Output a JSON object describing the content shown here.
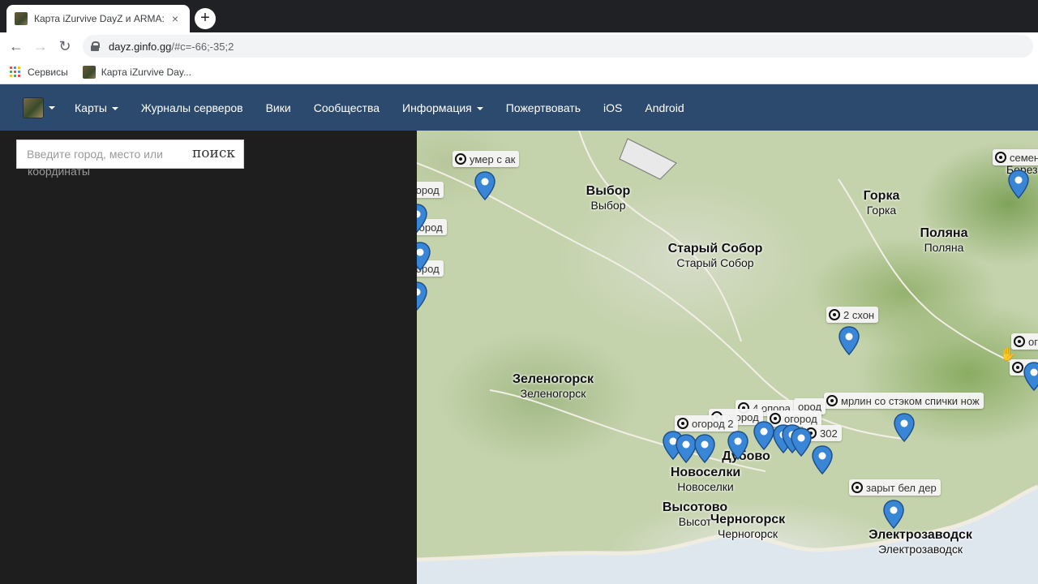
{
  "browser": {
    "tab_title": "Карта iZurvive DayZ и ARMA: Че",
    "tab_close": "×",
    "new_tab": "+",
    "url_host": "dayz.ginfo.gg",
    "url_path": "/#c=-66;-35;2",
    "bookmarks": [
      {
        "label": "Сервисы"
      },
      {
        "label": "Карта iZurvive Day..."
      }
    ]
  },
  "navbar": {
    "items": [
      {
        "label": "Карты",
        "dropdown": true
      },
      {
        "label": "Журналы серверов",
        "dropdown": false
      },
      {
        "label": "Вики",
        "dropdown": false
      },
      {
        "label": "Сообщества",
        "dropdown": false
      },
      {
        "label": "Информация",
        "dropdown": true
      },
      {
        "label": "Пожертвовать",
        "dropdown": false
      },
      {
        "label": "iOS",
        "dropdown": false
      },
      {
        "label": "Android",
        "dropdown": false
      }
    ]
  },
  "search": {
    "placeholder": "Введите город, место или",
    "placeholder_overflow": "координаты",
    "button": "поиск"
  },
  "map": {
    "towns": [
      {
        "en": "Выбор",
        "ru": "Выбор"
      },
      {
        "en": "Горка",
        "ru": "Горка"
      },
      {
        "en": "Поляна",
        "ru": "Поляна"
      },
      {
        "en": "Старый Собор",
        "ru": "Старый Собор"
      },
      {
        "en": "Зеленогорск",
        "ru": "Зеленогорск"
      },
      {
        "en": "Дубово",
        "ru": "Дубово"
      },
      {
        "en": "Новоселки",
        "ru": "Новоселки"
      },
      {
        "en": "Высотово",
        "ru": "Высот"
      },
      {
        "en": "Черногорск",
        "ru": "Черногорск"
      },
      {
        "en": "Электрозаводск",
        "ru": "Электрозаводск"
      },
      {
        "en": "",
        "ru": "Березин"
      }
    ],
    "markers": [
      {
        "label": "умер с ак"
      },
      {
        "label": "огород"
      },
      {
        "label": "огород"
      },
      {
        "label": "огород"
      },
      {
        "label": "2 схон"
      },
      {
        "label": "мрлин со стэком спички нож"
      },
      {
        "label": "4 опора"
      },
      {
        "label": "ород"
      },
      {
        "label": "огород"
      },
      {
        "label": "огород"
      },
      {
        "label": "огород 2"
      },
      {
        "label": "302"
      },
      {
        "label": "зарыт бел дер"
      },
      {
        "label": "семен"
      },
      {
        "label": "ого"
      },
      {
        "label": "ого"
      }
    ],
    "pin_color": "#3a86d6"
  }
}
